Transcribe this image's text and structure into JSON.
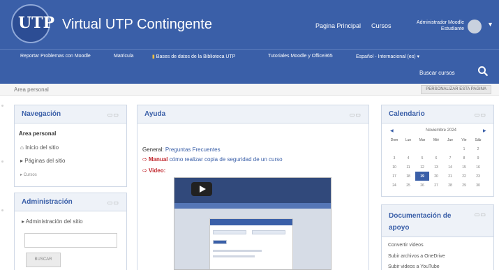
{
  "header": {
    "title": "Virtual UTP Contingente",
    "logo_text": "UTP",
    "links": [
      "Pagina Principal",
      "Cursos"
    ],
    "user_name": "Administrador Moodle",
    "user_role": "Estudiante"
  },
  "nav": {
    "items": [
      "Reportar Problemas con Moodle",
      "Matricula",
      "Bases de datos de la Biblioteca UTP",
      "Tutoriales Moodle y Office365",
      "Español - Internacional (es) ▾"
    ],
    "search_label": "Buscar cursos"
  },
  "breadcrumb": "Area personal",
  "customize_button": "PERSONALIZAR ESTA PAGINA",
  "navigation_block": {
    "title": "Navegación",
    "items": [
      "Area personal",
      "Inicio del sitio",
      "Páginas del sitio",
      "Cursos"
    ]
  },
  "admin_block": {
    "title": "Administración",
    "item": "Administración del sitio",
    "button": "BUSCAR"
  },
  "help_block": {
    "title": "Ayuda",
    "general_label": "General:",
    "general_link": "Preguntas Frecuentes",
    "manual_label": "Manual",
    "manual_text": "cómo realizar copia de seguridad de un curso",
    "video_label": "Video:"
  },
  "calendar_block": {
    "title": "Calendario",
    "month": "Noviembre 2024",
    "day_headers": [
      "Dom",
      "Lun",
      "Mar",
      "Mié",
      "Jue",
      "Vie",
      "Sáb"
    ],
    "weeks": [
      [
        "",
        "",
        "",
        "",
        "",
        "1",
        "2"
      ],
      [
        "3",
        "4",
        "5",
        "6",
        "7",
        "8",
        "9"
      ],
      [
        "10",
        "11",
        "12",
        "13",
        "14",
        "15",
        "16"
      ],
      [
        "17",
        "18",
        "19",
        "20",
        "21",
        "22",
        "23"
      ],
      [
        "24",
        "25",
        "26",
        "27",
        "28",
        "29",
        "30"
      ]
    ],
    "today": "19"
  },
  "docs_block": {
    "title": "Documentación de apoyo",
    "links": [
      "Convertir videos",
      "Subir archivos a OneDrive",
      "Subir videos a YouTube"
    ]
  },
  "colors": {
    "brand": "#3a5fa8",
    "link": "#3a5fa8",
    "accent_red": "#c0262c"
  }
}
